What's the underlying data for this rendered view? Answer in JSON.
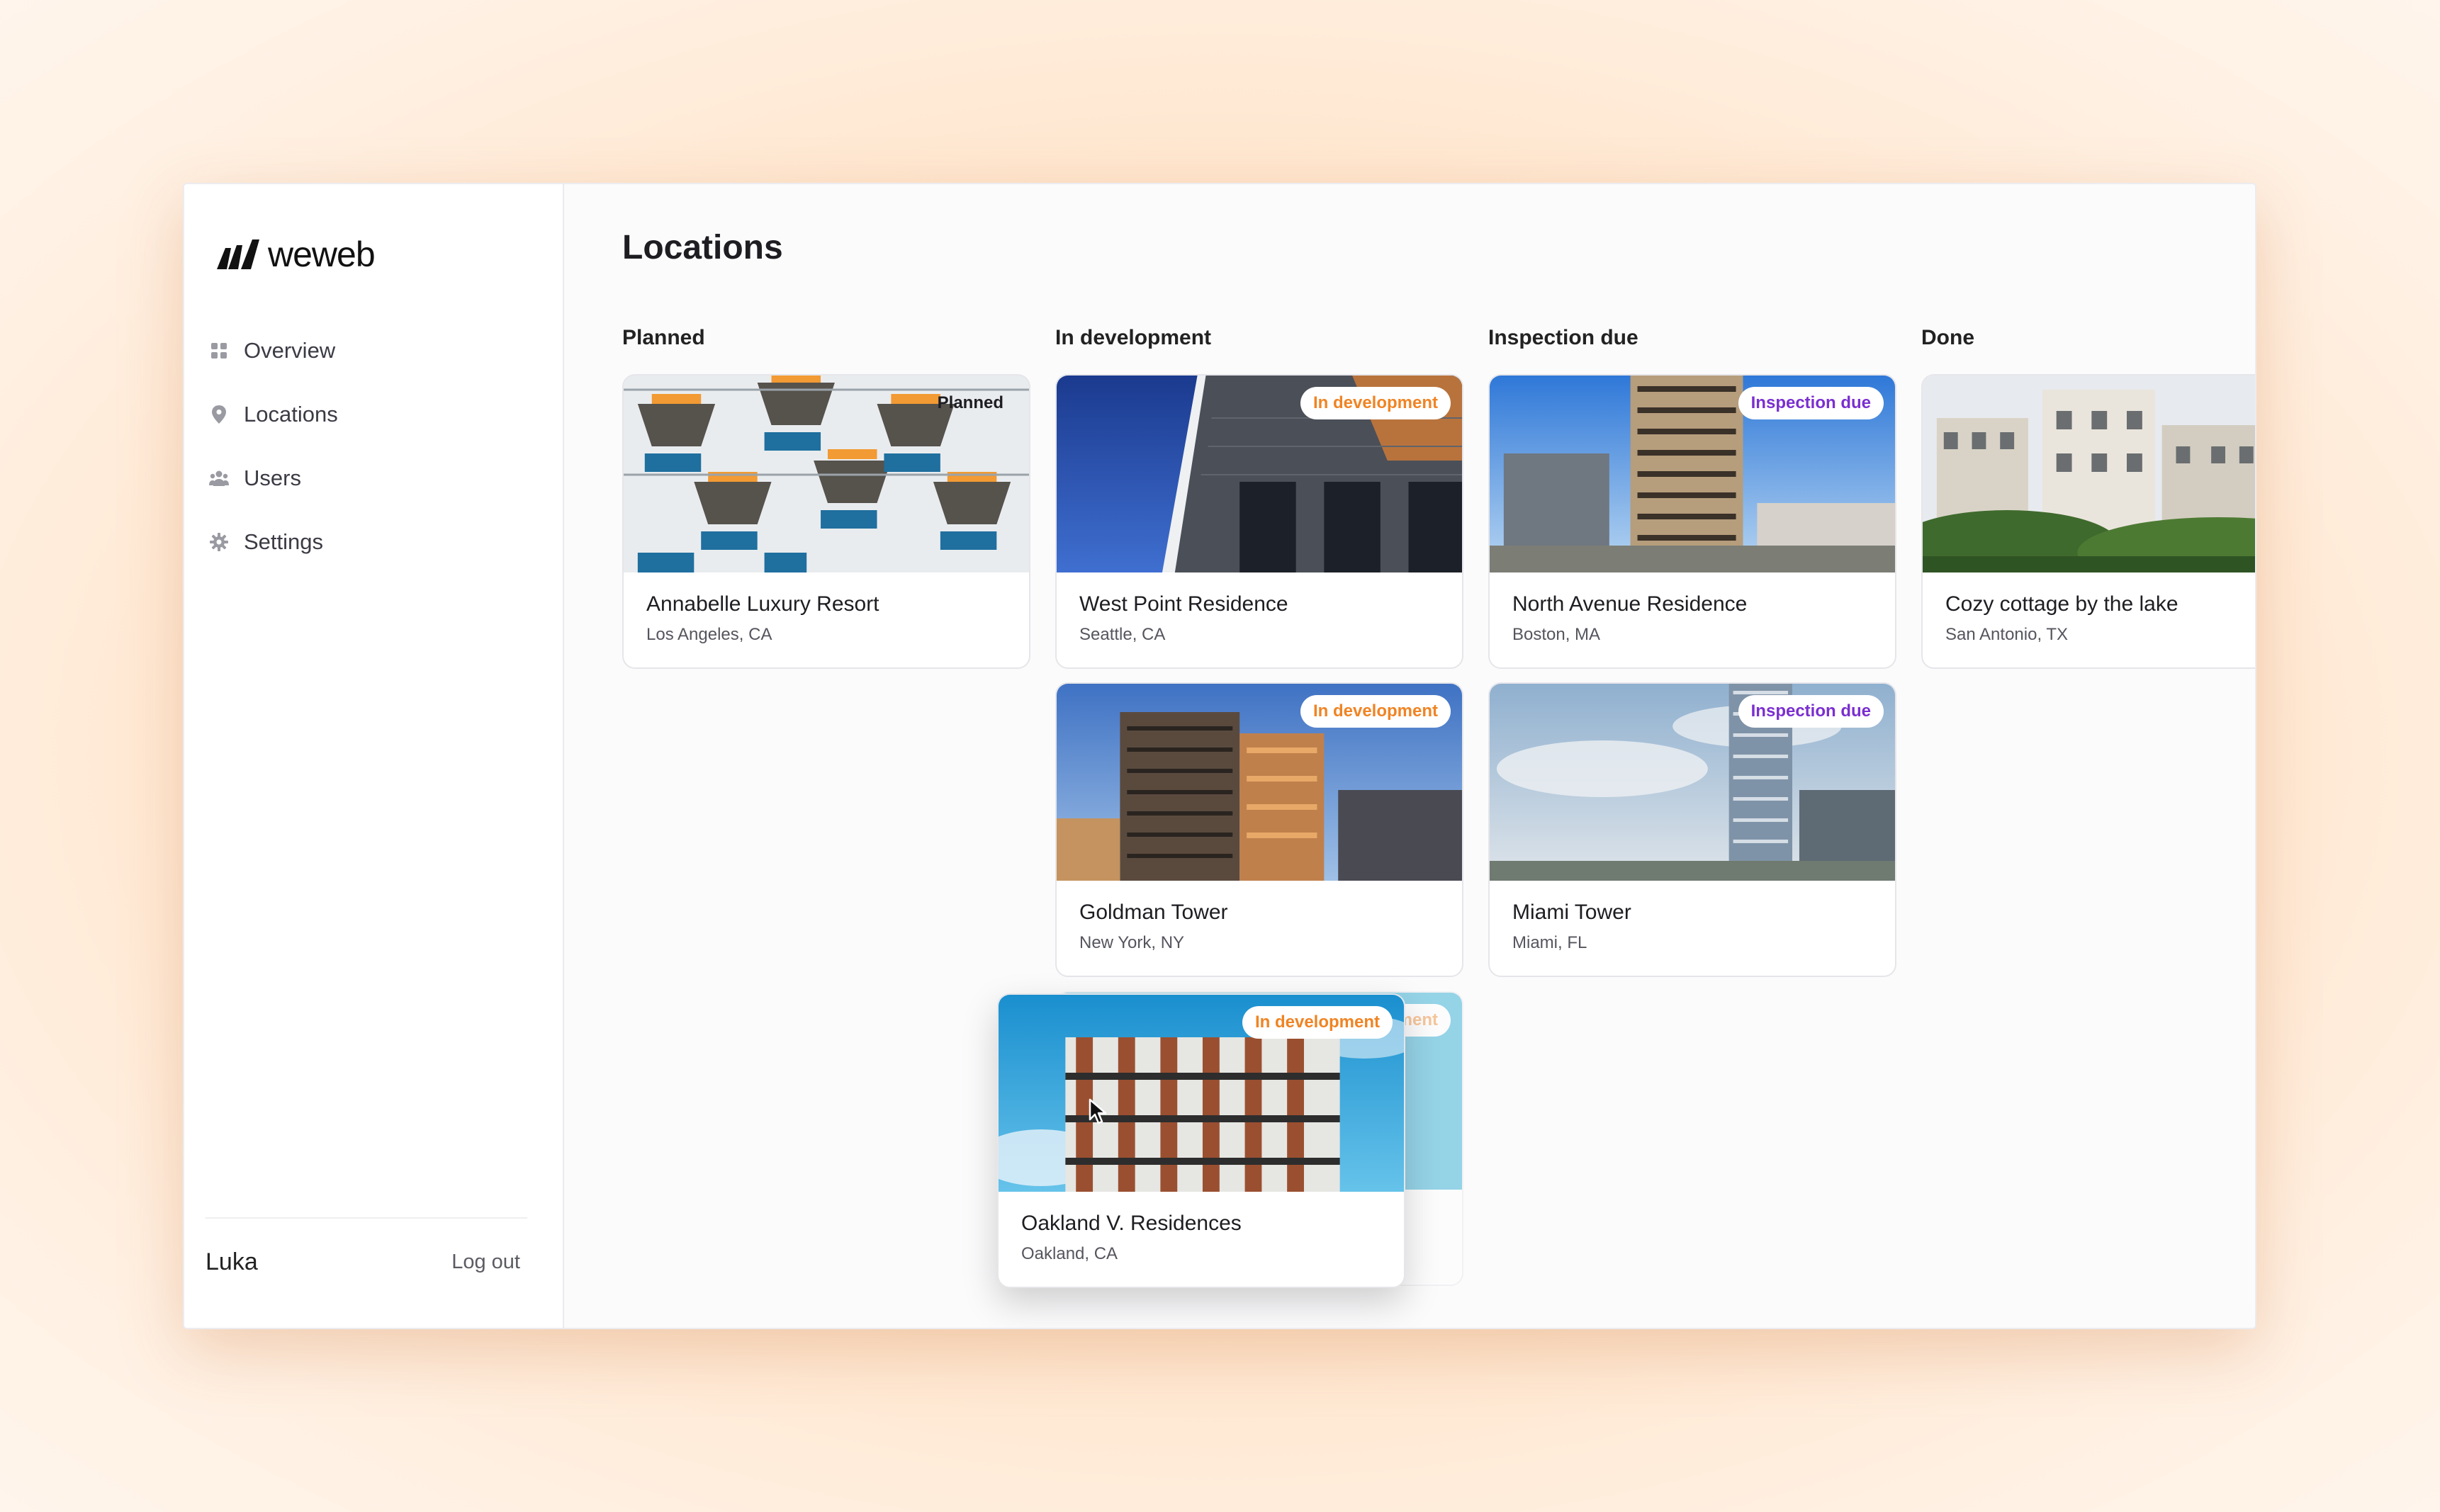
{
  "app": {
    "logo_text": "weweb"
  },
  "sidebar": {
    "items": [
      {
        "label": "Overview",
        "icon": "grid-icon"
      },
      {
        "label": "Locations",
        "icon": "pin-icon"
      },
      {
        "label": "Users",
        "icon": "users-icon"
      },
      {
        "label": "Settings",
        "icon": "gear-icon"
      }
    ],
    "user_name": "Luka",
    "logout_label": "Log out"
  },
  "main": {
    "title": "Locations",
    "columns": [
      {
        "title": "Planned"
      },
      {
        "title": "In development"
      },
      {
        "title": "Inspection due"
      },
      {
        "title": "Done"
      }
    ],
    "cards": [
      {
        "title": "Annabelle Luxury Resort",
        "location": "Los Angeles, CA",
        "status": "Planned"
      },
      {
        "title": "West Point Residence",
        "location": "Seattle, CA",
        "status": "In development"
      },
      {
        "title": "Goldman Tower",
        "location": "New York, NY",
        "status": "In development"
      },
      {
        "title": "North Avenue Residence",
        "location": "Boston, MA",
        "status": "Inspection due"
      },
      {
        "title": "Miami Tower",
        "location": "Miami, FL",
        "status": "Inspection due"
      },
      {
        "title": "Cozy cottage by the lake",
        "location": "San Antonio, TX",
        "status": ""
      },
      {
        "title": "Oakland V. Residences",
        "location": "Oakland, CA",
        "status": "In development"
      }
    ]
  },
  "colors": {
    "in_development": "#f08424",
    "inspection_due": "#7a2fd0",
    "background": "#ffe3c8"
  }
}
